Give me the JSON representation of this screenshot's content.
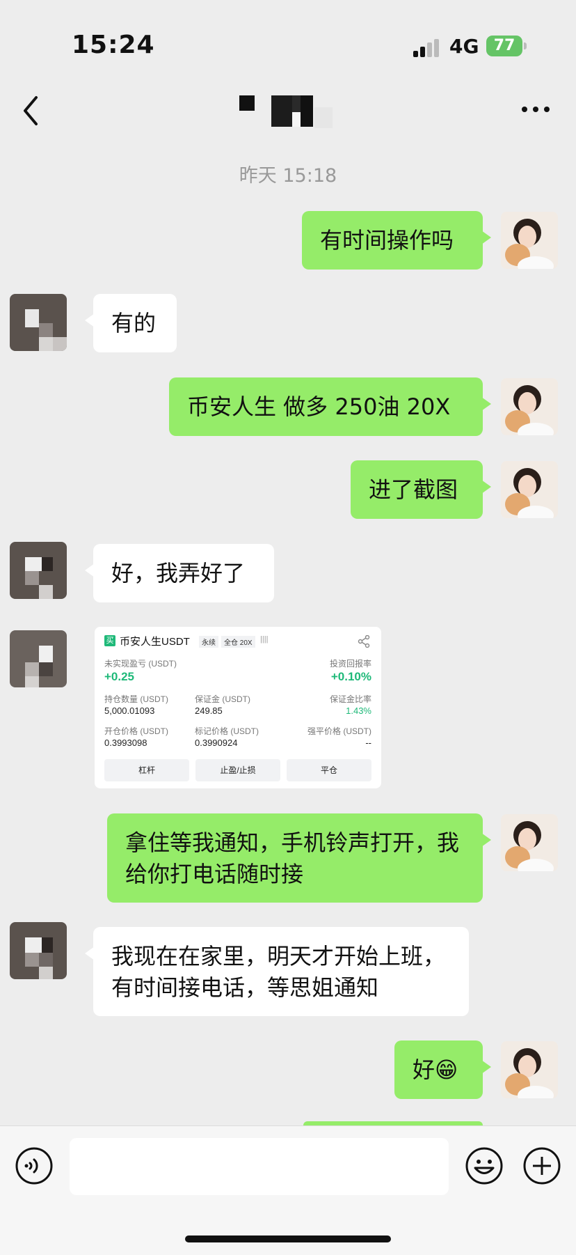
{
  "status": {
    "time": "15:24",
    "network": "4G",
    "battery": "77"
  },
  "header": {
    "time_separator": "昨天 15:18"
  },
  "messages": [
    {
      "side": "right",
      "text": "有时间操作吗"
    },
    {
      "side": "left",
      "text": "有的"
    },
    {
      "side": "right",
      "text": "币安人生 做多 250油 20X"
    },
    {
      "side": "right",
      "text": "进了截图"
    },
    {
      "side": "left",
      "text": "好，我弄好了"
    },
    {
      "side": "right",
      "text": "拿住等我通知，手机铃声打开，我给你打电话随时接"
    },
    {
      "side": "left",
      "text": "我现在在家里，明天才开始上班，有时间接电话，等思姐通知"
    },
    {
      "side": "right",
      "text": "好😁"
    }
  ],
  "card": {
    "badge": "买",
    "symbol": "币安人生USDT",
    "tag1": "永续",
    "tag2": "全仓 20X",
    "bars": "||||",
    "unrealized_label": "未实现盈亏 (USDT)",
    "unrealized_value": "+0.25",
    "roi_label": "投资回报率",
    "roi_value": "+0.10%",
    "qty_label": "持仓数量 (USDT)",
    "qty_value": "5,000.01093",
    "margin_label": "保证金 (USDT)",
    "margin_value": "249.85",
    "margin_ratio_label": "保证金比率",
    "margin_ratio_value": "1.43%",
    "open_price_label": "开仓价格 (USDT)",
    "open_price_value": "0.3993098",
    "mark_price_label": "标记价格 (USDT)",
    "mark_price_value": "0.3990924",
    "liq_label": "强平价格 (USDT)",
    "liq_value": "--",
    "buttons": [
      "杠杆",
      "止盈/止损",
      "平仓"
    ]
  },
  "colors": {
    "outgoing_bubble": "#95ec69",
    "incoming_bubble": "#ffffff",
    "background": "#ededed",
    "profit_green": "#1fb979",
    "battery_green": "#65c466"
  }
}
